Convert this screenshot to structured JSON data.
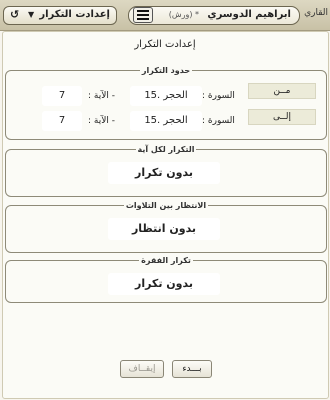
{
  "header": {
    "tab_label": "القاري",
    "reciter_name": "ابراهيم الدوسري",
    "reciter_sub": "* (ورش)",
    "settings_label": "إعدادت التكرار",
    "back_icon": "↺",
    "drop_icon": "▼",
    "menu_icon": "menu-icon"
  },
  "page": {
    "title": "إعدادت التكرار"
  },
  "range": {
    "legend": "حدود التكرار",
    "from": {
      "label": "مــن",
      "surah_label": "السورة :",
      "surah": "15. الحجر",
      "ayah_label": "- الآية :",
      "ayah": "7"
    },
    "to": {
      "label": "إلــى",
      "surah_label": "السورة :",
      "surah": "15. الحجر",
      "ayah_label": "- الآية :",
      "ayah": "7"
    }
  },
  "repeat_ayah": {
    "legend": "التكرار لكل آية",
    "value": "بدون تكرار"
  },
  "wait_between": {
    "legend": "الانتظار بين التلاوات",
    "value": "بدون انتظار"
  },
  "repeat_section": {
    "legend": "تكرار الفقرة",
    "value": "بدون تكرار"
  },
  "actions": {
    "start": "بـــدء",
    "stop": "إيقــاف"
  }
}
